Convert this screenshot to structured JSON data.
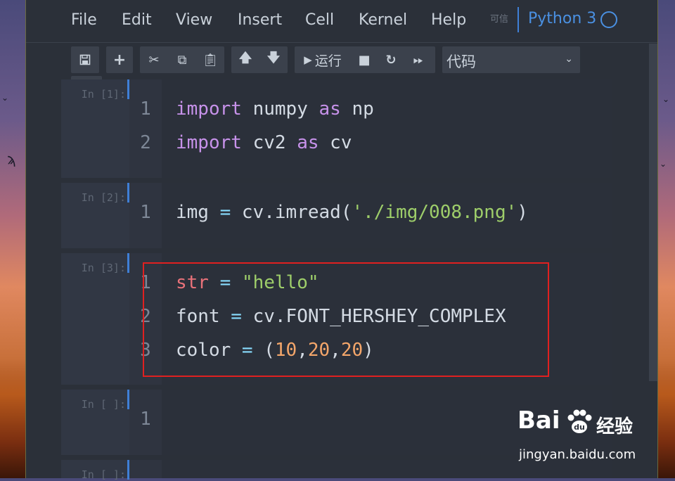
{
  "menu": {
    "items": [
      "File",
      "Edit",
      "View",
      "Insert",
      "Cell",
      "Kernel",
      "Help"
    ],
    "trusted_label": "可信",
    "kernel_name": "Python 3"
  },
  "toolbar": {
    "run_label": "运行",
    "cell_type": "代码"
  },
  "cells": [
    {
      "prompt": "In [1]:",
      "lines": [
        {
          "n": "1",
          "tokens": [
            [
              "kw",
              "import"
            ],
            [
              "",
              " numpy "
            ],
            [
              "kw",
              "as"
            ],
            [
              "",
              " np"
            ]
          ]
        },
        {
          "n": "2",
          "tokens": [
            [
              "kw",
              "import"
            ],
            [
              "",
              " cv2 "
            ],
            [
              "kw",
              "as"
            ],
            [
              "",
              " cv"
            ]
          ]
        }
      ]
    },
    {
      "prompt": "In [2]:",
      "lines": [
        {
          "n": "1",
          "tokens": [
            [
              "",
              "img "
            ],
            [
              "op",
              "="
            ],
            [
              "",
              " cv.imread("
            ],
            [
              "str",
              "'./img/008.png'"
            ],
            [
              "",
              ")"
            ]
          ]
        }
      ]
    },
    {
      "prompt": "In [3]:",
      "lines": [
        {
          "n": "1",
          "tokens": [
            [
              "var",
              "str"
            ],
            [
              "",
              " "
            ],
            [
              "op",
              "="
            ],
            [
              "",
              " "
            ],
            [
              "str",
              "\"hello\""
            ]
          ]
        },
        {
          "n": "2",
          "tokens": [
            [
              "",
              "font "
            ],
            [
              "op",
              "="
            ],
            [
              "",
              " cv.FONT_HERSHEY_COMPLEX"
            ]
          ]
        },
        {
          "n": "3",
          "tokens": [
            [
              "",
              "color "
            ],
            [
              "op",
              "="
            ],
            [
              "",
              " ("
            ],
            [
              "num",
              "10"
            ],
            [
              "",
              ","
            ],
            [
              "num",
              "20"
            ],
            [
              "",
              ","
            ],
            [
              "num",
              "20"
            ],
            [
              "",
              ")"
            ]
          ]
        }
      ]
    },
    {
      "prompt": "In [ ]:",
      "lines": [
        {
          "n": "1",
          "tokens": []
        }
      ]
    },
    {
      "prompt": "In [ ]:",
      "lines": []
    }
  ],
  "watermark": {
    "logo": "Bai",
    "logo_suffix": "经验",
    "url": "jingyan.baidu.com"
  },
  "colors": {
    "accent": "#3f7fd6",
    "highlight_border": "#e02020"
  }
}
